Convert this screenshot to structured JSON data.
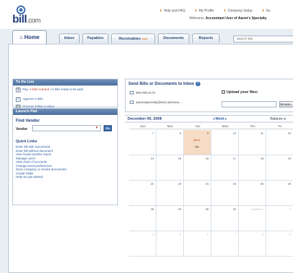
{
  "logo": {
    "name": "bill",
    "suffix": ".com"
  },
  "top_links": [
    "Help and FAQ",
    "My Profile",
    "Company Setup",
    "Su"
  ],
  "welcome": {
    "prefix": "Welcome,",
    "user": "Accountant User of Aaron's Specialty"
  },
  "tabs": [
    {
      "label": "Home",
      "active": true
    },
    {
      "label": "Inbox"
    },
    {
      "label": "Payables"
    },
    {
      "label": "Receivables",
      "badge": "new"
    },
    {
      "label": "Documents"
    },
    {
      "label": "Reports"
    }
  ],
  "search": {
    "placeholder": "Search Site"
  },
  "todo": {
    "title": "To Do List",
    "items": [
      {
        "icon": "bill-icon",
        "prefix": "Pay:",
        "overdue": "4 bills overdue",
        "suffix": "| 4 bills ready to be paid"
      },
      {
        "icon": "approve-icon",
        "text": "Approve 2 bills"
      },
      {
        "icon": "inbox-icon",
        "text": "Process 8 files in Inbox"
      }
    ]
  },
  "launch_pad": {
    "title": "Launch Pad",
    "find_vendor_title": "Find Vendor",
    "vendor_label": "Vendor",
    "go_label": "Go",
    "quick_links_title": "Quick Links",
    "quick_links": [
      "Enter bill with documents",
      "Enter bill without document",
      "View funds transfer report",
      "Manage users",
      "View chart of accounts",
      "Change email preferences",
      "Store company or vendor documents",
      "Create folder",
      "Help me get started"
    ]
  },
  "send": {
    "title": "Send Bills or Documents to Inbox",
    "fax": "650-493-4172",
    "email": "aaronsspecialty@test.cashview....",
    "upload_label": "Upload your files:",
    "browse_label": "Browse..."
  },
  "calendar": {
    "date_label": "December 09, 2008",
    "week_label": "Week",
    "balance_label": "Balance a",
    "days": [
      "Sun",
      "Mon",
      "Tue",
      "Wed",
      "Thu",
      "Fri"
    ],
    "weeks": [
      [
        "7",
        "8",
        "9",
        "10",
        "11",
        "12"
      ],
      [
        "14",
        "15",
        "16",
        "17",
        "18",
        "19"
      ],
      [
        "21",
        "22",
        "23",
        "24",
        "25",
        "26"
      ],
      [
        "28",
        "29",
        "30",
        "31",
        "January 1",
        "2"
      ],
      [
        "4",
        "5",
        "6",
        "7",
        "8",
        "9"
      ]
    ],
    "today_red_note": "($10)",
    "today_blue_note": "+$0"
  },
  "colors": {
    "brand": "#1f3d78",
    "accent": "#e07a1f",
    "link": "#2a5aa0",
    "today": "#f6dcc4"
  }
}
